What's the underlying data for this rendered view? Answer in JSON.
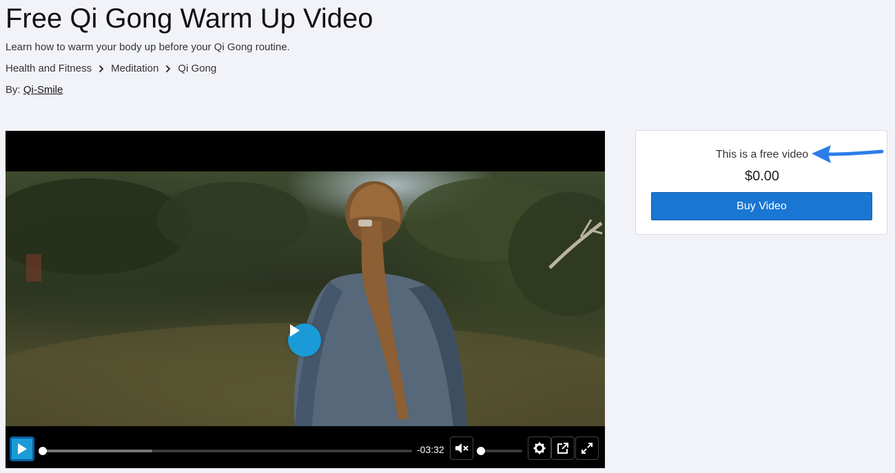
{
  "page": {
    "title": "Free Qi Gong Warm Up Video",
    "subtitle": "Learn how to warm your body up before your Qi Gong routine.",
    "breadcrumb": [
      "Health and Fitness",
      "Meditation",
      "Qi Gong"
    ],
    "byline_prefix": "By:",
    "author": "Qi-Smile"
  },
  "player": {
    "time_remaining": "-03:32",
    "progress_fraction": 0.0,
    "buffered_fraction": 0.14,
    "volume_fraction": 0.0,
    "muted": true,
    "accent_color": "#1a9bd7"
  },
  "purchase": {
    "note": "This is a free video",
    "price": "$0.00",
    "button_label": "Buy Video",
    "button_color": "#1976d2"
  },
  "annotation": {
    "arrow_color": "#2b7de9"
  },
  "icons": [
    "chevron-right-icon",
    "play-icon",
    "mute-icon",
    "settings-gear-icon",
    "popout-icon",
    "fullscreen-icon",
    "arrow-annotation"
  ]
}
